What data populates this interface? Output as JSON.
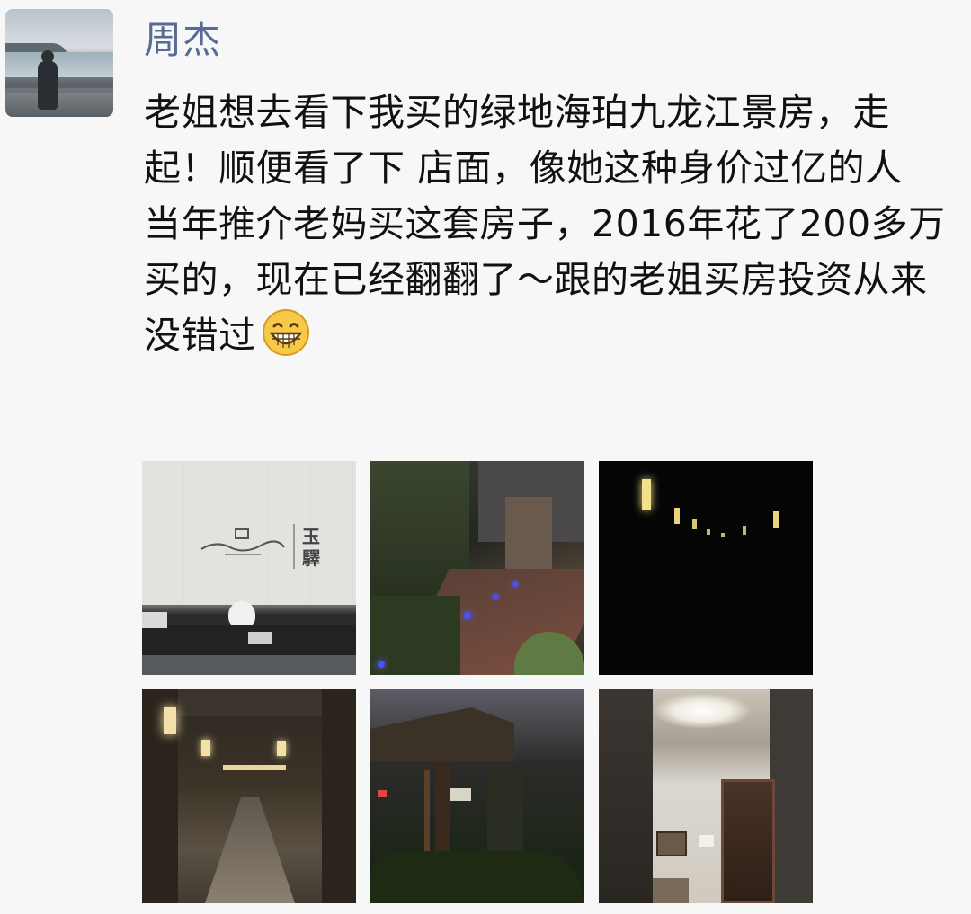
{
  "post": {
    "username": "周杰",
    "text": "老姐想去看下我买的绿地海珀九龙江景房，走起！顺便看了下 店面，像她这种身价过亿的人  当年推介老妈买这套房子，2016年花了200多万买的，现在已经翻翻了～跟的老姐买房投资从来没错过",
    "emoji_icon": "grinning-face-emoji"
  },
  "photos": [
    {
      "scene": "lobby-reception"
    },
    {
      "scene": "garden-path-night"
    },
    {
      "scene": "dark-corridor-lights"
    },
    {
      "scene": "arcade-walkway-night"
    },
    {
      "scene": "garden-signpost-night"
    },
    {
      "scene": "elevator-lobby"
    }
  ],
  "photo_wall_text": {
    "logo_cn": "玉",
    "logo_cn2": "驛"
  },
  "colors": {
    "username": "#576b95",
    "text": "#111111",
    "background": "#f7f7f8"
  }
}
